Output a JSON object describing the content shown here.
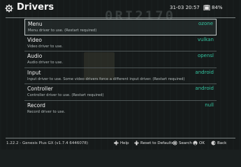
{
  "header": {
    "title": "Drivers",
    "title_icon": "gear-icon",
    "clock": "31-03 20:57",
    "battery_icon": "battery-icon",
    "battery_percent": "84%"
  },
  "items": [
    {
      "label": "Menu",
      "value": "ozone",
      "description": "Menu driver to use. (Restart required)"
    },
    {
      "label": "Video",
      "value": "vulkan",
      "description": "Video driver to use."
    },
    {
      "label": "Audio",
      "value": "opensl",
      "description": "Audio driver to use."
    },
    {
      "label": "Input",
      "value": "android",
      "description": "Input driver to use. Some video drivers force a different input driver. (Restart required)"
    },
    {
      "label": "Controller",
      "value": "android",
      "description": "Controller driver to use. (Restart required)"
    },
    {
      "label": "Record",
      "value": "null",
      "description": "Record driver to use."
    }
  ],
  "footer": {
    "version": "1.22.2 - Genesis Plus GX (v1.7.4 6446078)",
    "hints": [
      {
        "icon": "dpad-left-icon",
        "label": "Help"
      },
      {
        "icon": "dpad-down-icon",
        "label": "Reset to Defaults"
      },
      {
        "icon": "search-icon",
        "label": "Search"
      },
      {
        "icon": "confirm-button-icon",
        "label": "OK"
      },
      {
        "icon": "back-button-icon",
        "label": "Back"
      }
    ]
  },
  "colors": {
    "value_accent": "#33c4a0",
    "background": "#1a1f1f"
  }
}
